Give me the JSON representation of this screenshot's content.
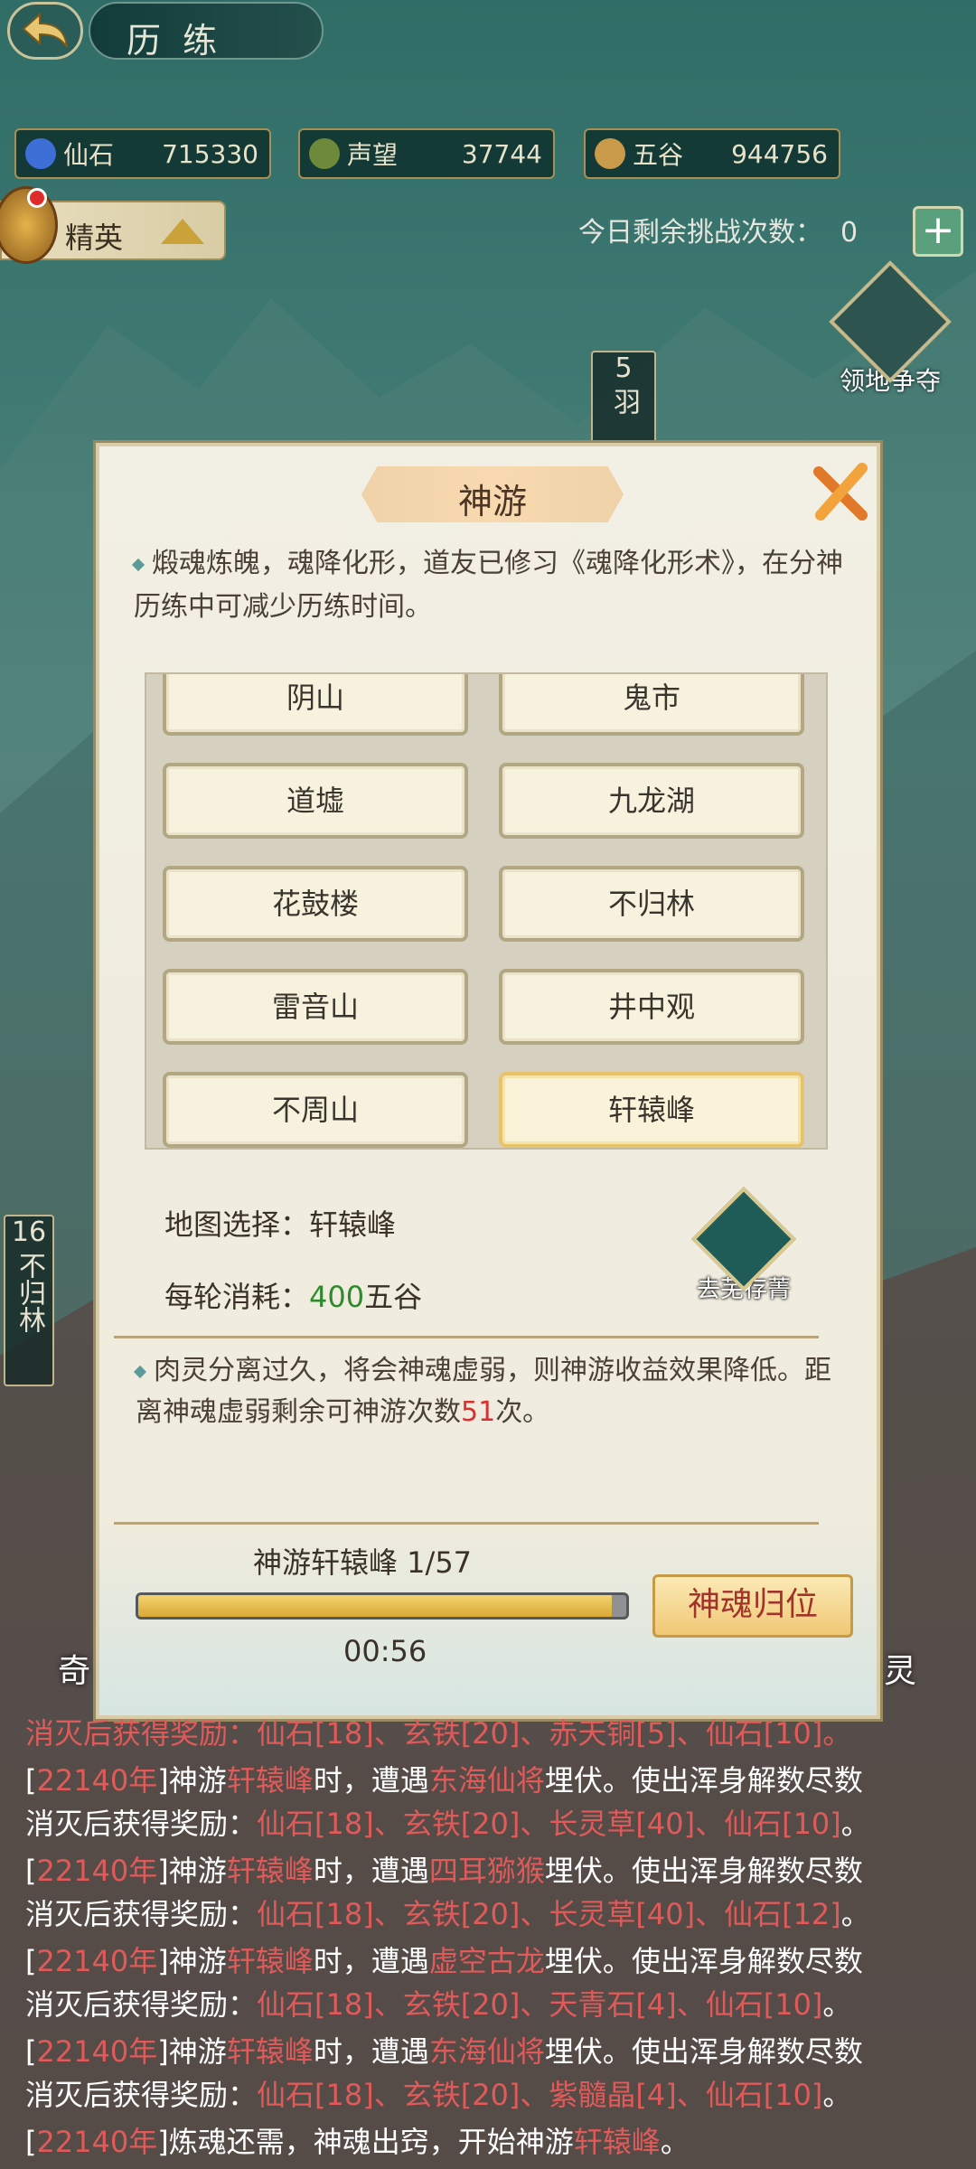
{
  "header": {
    "title": "历 练"
  },
  "resources": [
    {
      "name": "仙石",
      "value": "715330",
      "color": "#3d6fd6"
    },
    {
      "name": "声望",
      "value": "37744",
      "color": "#6d8a3a"
    },
    {
      "name": "五谷",
      "value": "944756",
      "color": "#c99a4a"
    }
  ],
  "elite": {
    "label": "精英"
  },
  "challenge": {
    "label": "今日剩余挑战次数：",
    "count": "0"
  },
  "territory": {
    "label": "领地争夺"
  },
  "markers": {
    "m5": {
      "num": "5",
      "text": "羽"
    },
    "m16": {
      "num": "16",
      "text": "不归林"
    }
  },
  "sides": {
    "left": "奇",
    "right": "灵"
  },
  "dialog": {
    "title": "神游",
    "intro": "煅魂炼魄，魂降化形，道友已修习《魂降化形术》，在分神历练中可减少历练时间。",
    "maps": [
      "阴山",
      "鬼市",
      "道墟",
      "九龙湖",
      "花鼓楼",
      "不归林",
      "雷音山",
      "井中观",
      "不周山",
      "轩辕峰"
    ],
    "selected_index": 9,
    "map_label": "地图选择：",
    "map_value": "轩辕峰",
    "cost_label": "每轮消耗：",
    "cost_num": "400",
    "cost_unit": "五谷",
    "shop_label": "去芜存菁",
    "note_a": "肉灵分离过久，将会神魂虚弱，则神游收益效果降低。距离神魂虚弱剩余可神游次数",
    "note_num": "51",
    "note_b": "次。",
    "progress_label": "神游轩辕峰  1/57",
    "progress_fraction": 0.97,
    "timer": "00:56",
    "recall_label": "神魂归位"
  },
  "log": [
    {
      "year": "22140年",
      "place": "轩辕峰",
      "enemy": "东海仙将",
      "rewards": "仙石[18]、玄铁[20]、长灵草[40]、仙石[10]"
    },
    {
      "year": "22140年",
      "place": "轩辕峰",
      "enemy": "四耳猕猴",
      "rewards": "仙石[18]、玄铁[20]、长灵草[40]、仙石[12]"
    },
    {
      "year": "22140年",
      "place": "轩辕峰",
      "enemy": "虚空古龙",
      "rewards": "仙石[18]、玄铁[20]、天青石[4]、仙石[10]"
    },
    {
      "year": "22140年",
      "place": "轩辕峰",
      "enemy": "东海仙将",
      "rewards": "仙石[18]、玄铁[20]、紫髓晶[4]、仙石[10]"
    }
  ],
  "log_partial_top": "消灭后获得奖励：仙石[18]、玄铁[20]、赤天铜[5]、仙石[10]。",
  "log_last": {
    "year": "22140年",
    "text": "炼魂还需，神魂出窍，开始神游",
    "place": "轩辕峰"
  },
  "log_text": {
    "a": "神游",
    "b": "时，遭遇",
    "c": "埋伏。使出浑身解数尽数",
    "d": "消灭后获得奖励：",
    "e": "。"
  }
}
